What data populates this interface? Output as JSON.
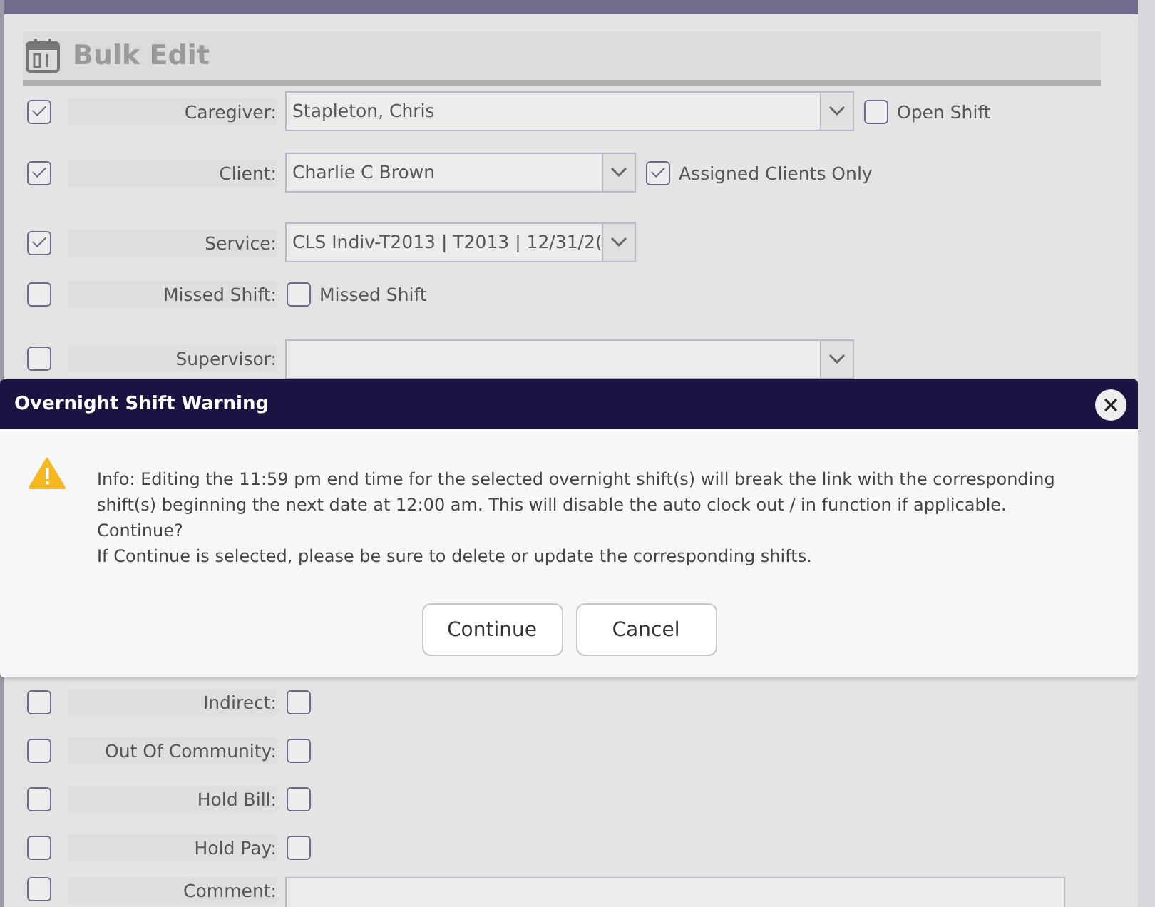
{
  "panel": {
    "title": "Bulk Edit"
  },
  "rows_top": [
    {
      "kind": "select",
      "checked": true,
      "label": "Caregiver:",
      "value": "Stapleton, Chris",
      "wide": true,
      "option": {
        "label": "Open Shift",
        "checked": false
      }
    },
    {
      "kind": "select",
      "checked": true,
      "label": "Client:",
      "value": "Charlie C Brown",
      "wide": false,
      "option": {
        "label": "Assigned Clients Only",
        "checked": true
      }
    },
    {
      "kind": "select",
      "checked": true,
      "label": "Service:",
      "value": "CLS Indiv-T2013 | T2013 | 12/31/2(",
      "wide": false
    },
    {
      "kind": "checkbox",
      "checked": false,
      "label": "Missed Shift:",
      "option": {
        "label": "Missed Shift",
        "checked": false
      }
    },
    {
      "kind": "select",
      "checked": false,
      "label": "Supervisor:",
      "wide": true
    }
  ],
  "dialog": {
    "title": "Overnight Shift Warning",
    "paragraphs": [
      "Info: Editing the 11:59 pm end time for the selected overnight shift(s) will break the link with the corresponding shift(s) beginning the next date at 12:00 am. This will disable the auto clock out / in function if applicable.",
      "Continue?",
      "If Continue is selected, please be sure to delete or update the corresponding shifts."
    ],
    "buttons": [
      "Continue",
      "Cancel"
    ]
  },
  "rows_bottom": [
    {
      "kind": "checkbox",
      "checked": false,
      "label": "Indirect:",
      "option": {
        "checked": false
      }
    },
    {
      "kind": "checkbox",
      "checked": false,
      "label": "Out Of Community:",
      "option": {
        "checked": false
      }
    },
    {
      "kind": "checkbox",
      "checked": false,
      "label": "Hold Bill:",
      "option": {
        "checked": false
      }
    },
    {
      "kind": "checkbox",
      "checked": false,
      "label": "Hold Pay:",
      "option": {
        "checked": false
      }
    },
    {
      "kind": "text",
      "checked": false,
      "label": "Comment:"
    }
  ]
}
